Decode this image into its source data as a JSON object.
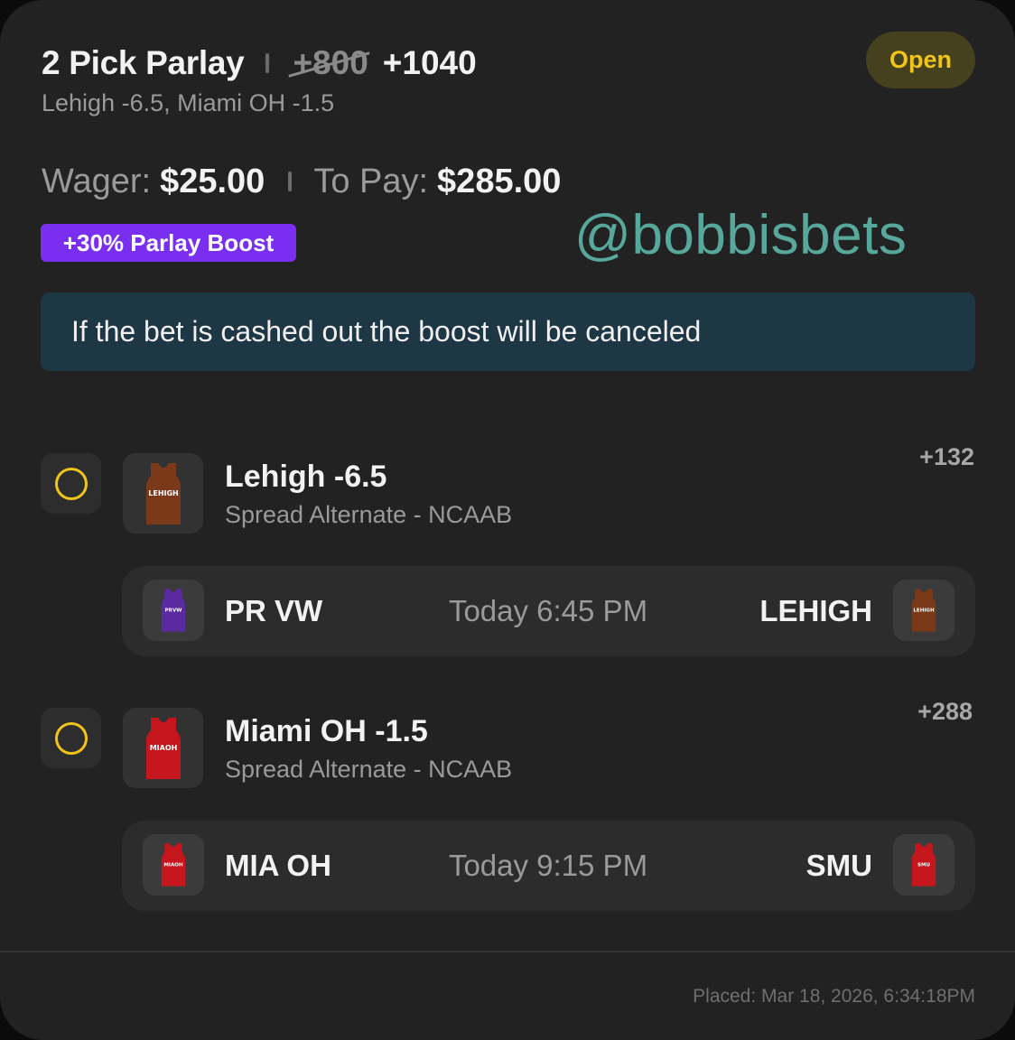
{
  "header": {
    "title": "2 Pick Parlay",
    "original_odds": "+800",
    "boosted_odds": "+1040",
    "legs_summary": "Lehigh -6.5, Miami OH -1.5",
    "status": "Open"
  },
  "wager": {
    "wager_label": "Wager:",
    "wager_value": "$25.00",
    "payout_label": "To Pay:",
    "payout_value": "$285.00"
  },
  "boost_badge": "+30% Parlay Boost",
  "watermark": "@bobbisbets",
  "notice": "If the bet is cashed out the boost will be canceled",
  "legs": [
    {
      "selection": "Lehigh -6.5",
      "market": "Spread Alternate - NCAAB",
      "odds": "+132",
      "jersey_text": "LEHIGH",
      "jersey_color": "#7a3a1a",
      "game": {
        "home_team": "PR VW",
        "home_jersey_text": "PRVW",
        "home_jersey_color": "#5a2aa0",
        "time": "Today 6:45 PM",
        "away_team": "LEHIGH",
        "away_jersey_text": "LEHIGH",
        "away_jersey_color": "#7a3a1a"
      }
    },
    {
      "selection": "Miami OH -1.5",
      "market": "Spread Alternate - NCAAB",
      "odds": "+288",
      "jersey_text": "MIAOH",
      "jersey_color": "#c4161c",
      "game": {
        "home_team": "MIA OH",
        "home_jersey_text": "MIAOH",
        "home_jersey_color": "#c4161c",
        "time": "Today 9:15 PM",
        "away_team": "SMU",
        "away_jersey_text": "SMU",
        "away_jersey_color": "#c4161c"
      }
    }
  ],
  "placed": "Placed: Mar 18, 2026, 6:34:18PM",
  "colors": {
    "card_bg": "#222223",
    "status_text": "#f1c419",
    "boost_bg": "#7a2ff0",
    "notice_bg": "#1e3744",
    "watermark": "#57a79b"
  }
}
